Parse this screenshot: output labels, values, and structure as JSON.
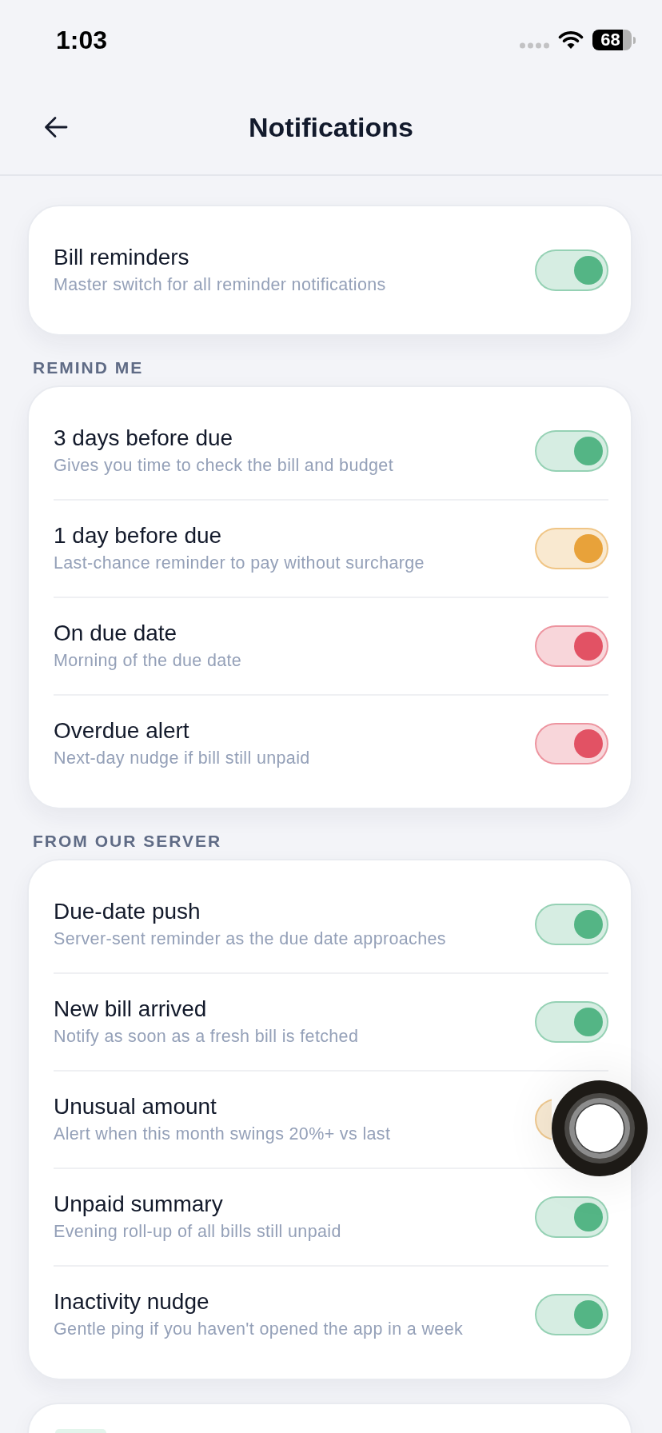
{
  "status_bar": {
    "time": "1:03",
    "battery": "68"
  },
  "header": {
    "title": "Notifications"
  },
  "sections": [
    {
      "rows": [
        {
          "kind": "switch",
          "title": "Bill reminders",
          "description": "Master switch for all reminder notifications",
          "on": true,
          "color": "#54b585"
        }
      ]
    },
    {
      "label": "REMIND ME",
      "rows": [
        {
          "kind": "switch",
          "title": "3 days before due",
          "description": "Gives you time to check the bill and budget",
          "on": true,
          "color": "#54b585"
        },
        {
          "kind": "switch",
          "title": "1 day before due",
          "description": "Last-chance reminder to pay without surcharge",
          "on": true,
          "color": "#e8a23a"
        },
        {
          "kind": "switch",
          "title": "On due date",
          "description": "Morning of the due date",
          "on": true,
          "color": "#e25264"
        },
        {
          "kind": "switch",
          "title": "Overdue alert",
          "description": "Next-day nudge if bill still unpaid",
          "on": true,
          "color": "#e25264"
        }
      ]
    },
    {
      "label": "FROM OUR SERVER",
      "rows": [
        {
          "kind": "switch",
          "title": "Due-date push",
          "description": "Server-sent reminder as the due date approaches",
          "on": true,
          "color": "#54b585"
        },
        {
          "kind": "switch",
          "title": "New bill arrived",
          "description": "Notify as soon as a fresh bill is fetched",
          "on": true,
          "color": "#54b585"
        },
        {
          "kind": "partial-switch",
          "title": "Unusual amount",
          "description": "Alert when this month swings 20%+ vs last",
          "on": true,
          "color": "#f8ead3"
        },
        {
          "kind": "switch",
          "title": "Unpaid summary",
          "description": "Evening roll-up of all bills still unpaid",
          "on": true,
          "color": "#54b585"
        },
        {
          "kind": "switch",
          "title": "Inactivity nudge",
          "description": "Gentle ping if you haven't opened the app in a week",
          "on": true,
          "color": "#54b585"
        }
      ]
    }
  ]
}
